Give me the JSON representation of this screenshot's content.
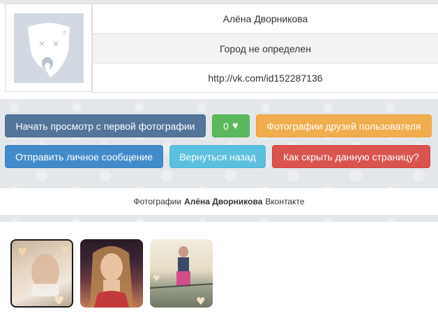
{
  "profile": {
    "name": "Алёна Дворникова",
    "city": "Город не определен",
    "url": "http://vk.com/id152287136"
  },
  "buttons": {
    "start_view": "Начать просмотр с первой фотографии",
    "likes": "0",
    "friends_photos": "Фотографии друзей пользователя",
    "send_message": "Отправить личное сообщение",
    "go_back": "Вернуться назад",
    "hide_page": "Как скрыть данную страницу?"
  },
  "caption": {
    "prefix": "Фотографии",
    "name": "Алёна Дворникова",
    "suffix": "Вконтакте"
  },
  "icons": {
    "heart": "heart-icon",
    "avatar": "dog-avatar-icon"
  },
  "colors": {
    "dark_button": "#537599",
    "green_button": "#5cb85c",
    "orange_button": "#f0ad4e",
    "blue_button": "#428bca",
    "cyan_button": "#5bc0de",
    "red_button": "#d9534f"
  }
}
